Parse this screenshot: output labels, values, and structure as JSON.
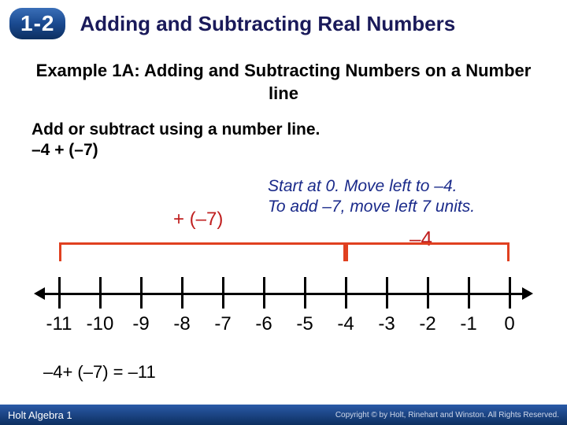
{
  "header": {
    "section_number": "1-2",
    "chapter_title": "Adding and Subtracting Real Numbers"
  },
  "example": {
    "title": "Example 1A: Adding and Subtracting Numbers on a Number line",
    "instruction": "Add or subtract using a number line.",
    "expression": "–4 + (–7)",
    "hint_line1": "Start at 0. Move left to –4.",
    "hint_line2": "To add –7, move left 7 units.",
    "op_label": "+ (–7)",
    "second_jump_label": "–4",
    "result": "–4+ (–7) = –11"
  },
  "numberline": {
    "ticks": [
      "-11",
      "-10",
      "-9",
      "-8",
      "-7",
      "-6",
      "-5",
      "-4",
      "-3",
      "-2",
      "-1",
      "0"
    ]
  },
  "footer": {
    "book": "Holt Algebra 1",
    "copyright": "Copyright © by Holt, Rinehart and Winston. All Rights Reserved."
  },
  "chart_data": {
    "type": "other",
    "description": "Number line from -11 to 0 with two jump brackets",
    "axis_start": -11,
    "axis_end": 0,
    "tick_interval": 1,
    "jumps": [
      {
        "label": "+ (–7)",
        "from": -4,
        "to": -11
      },
      {
        "label": "–4",
        "from": 0,
        "to": -4
      }
    ],
    "result_value": -11
  }
}
